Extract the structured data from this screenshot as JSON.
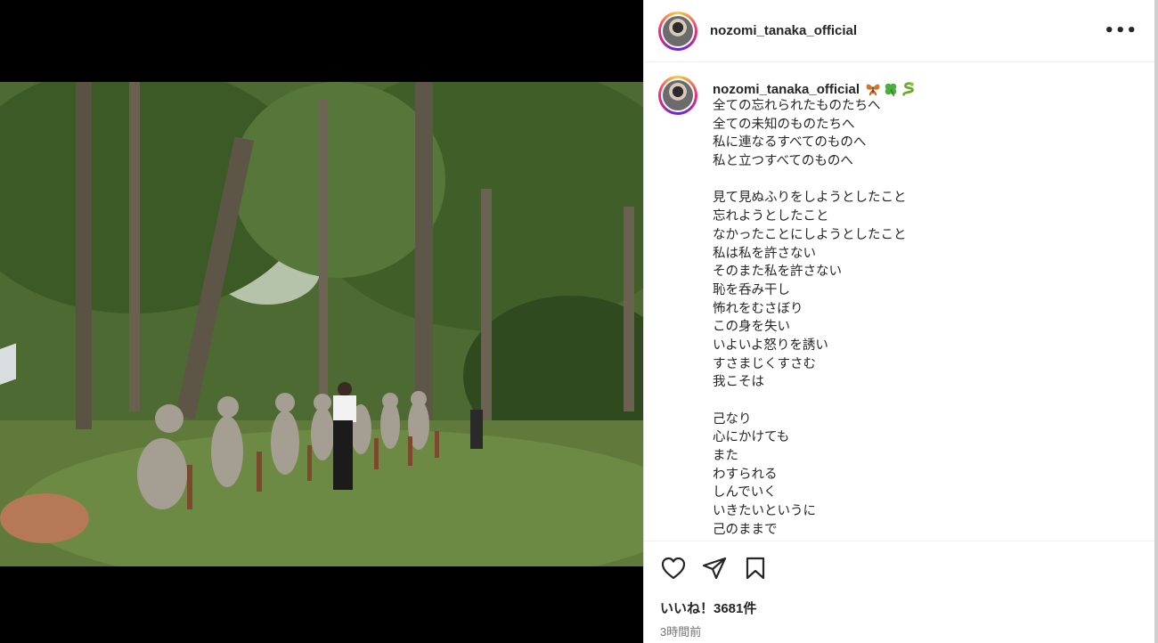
{
  "post": {
    "username": "nozomi_tanaka_official",
    "caption": {
      "username": "nozomi_tanaka_official",
      "emojis": [
        "butterfly-emoji",
        "four-leaf-clover-emoji",
        "snake-emoji"
      ],
      "lines": [
        "全ての忘れられたものたちへ",
        "全ての未知のものたちへ",
        "私に連なるすべてのものへ",
        "私と立つすべてのものへ",
        "",
        "見て見ぬふりをしようとしたこと",
        "忘れようとしたこと",
        "なかったことにしようとしたこと",
        "私は私を許さない",
        "そのまた私を許さない",
        "恥を呑み干し",
        "怖れをむさぼり",
        "この身を失い",
        "いよいよ怒りを誘い",
        "すさまじくすさむ",
        "我こそは",
        "",
        "己なり",
        "心にかけても",
        "また",
        "わすられる",
        "しんでいく",
        "いきたいというに",
        "己のままで"
      ]
    },
    "likes_label": "いいね！3681件",
    "timestamp": "3時間前",
    "more_icon": "•••"
  },
  "colors": {
    "text": "#262626",
    "muted": "#737373",
    "divider": "#efefef"
  }
}
